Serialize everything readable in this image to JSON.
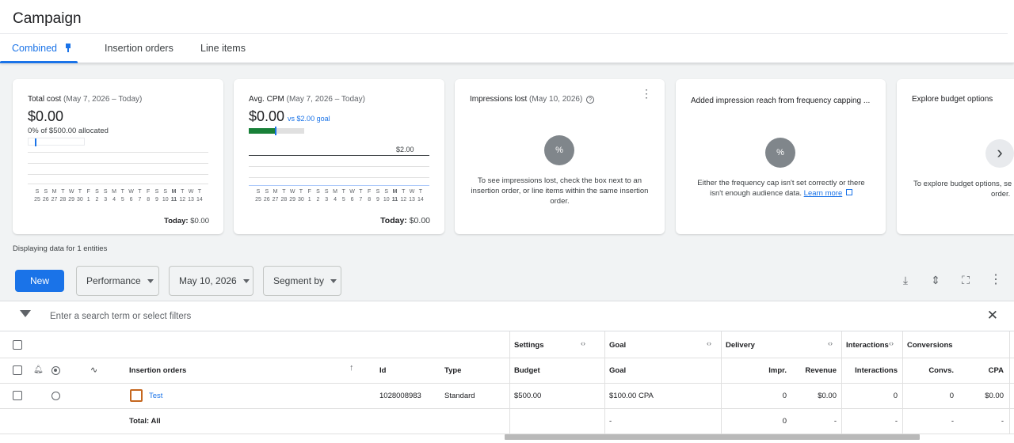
{
  "header": {
    "title": "Campaign",
    "tabs": [
      {
        "label": "Combined"
      },
      {
        "label": "Insertion orders"
      },
      {
        "label": "Line items"
      }
    ]
  },
  "cards": {
    "total_cost": {
      "title": "Total cost",
      "range": "(May 7, 2026 – Today)",
      "value": "$0.00",
      "note": "0% of $500.00 allocated",
      "today_label": "Today:",
      "today_value": "$0.00"
    },
    "avg_cpm": {
      "title": "Avg. CPM",
      "range": "(May 7, 2026 – Today)",
      "value": "$0.00",
      "goal": "vs $2.00 goal",
      "goal_line_label": "$2.00",
      "today_label": "Today:",
      "today_value": "$0.00"
    },
    "impressions_lost": {
      "title": "Impressions lost",
      "range": "(May 10, 2026)",
      "icon": "%",
      "message": "To see impressions lost, check the box next to an insertion order, or line items within the same insertion order."
    },
    "frequency": {
      "title": "Added impression reach from frequency capping ...",
      "icon": "%",
      "message": "Either the frequency cap isn't set correctly or there isn't enough audience data.",
      "link": "Learn more"
    },
    "budget": {
      "title": "Explore budget options",
      "message": "To explore budget options, se",
      "message2": "order."
    }
  },
  "chart_days": [
    "S",
    "S",
    "M",
    "T",
    "W",
    "T",
    "F",
    "S",
    "S",
    "M",
    "T",
    "W",
    "T",
    "F",
    "S",
    "S",
    "M",
    "T",
    "W",
    "T"
  ],
  "chart_dates": [
    "25",
    "26",
    "27",
    "28",
    "29",
    "30",
    "1",
    "2",
    "3",
    "4",
    "5",
    "6",
    "7",
    "8",
    "9",
    "10",
    "11",
    "12",
    "13",
    "14"
  ],
  "toolbar": {
    "displaying": "Displaying data for 1 entities",
    "new_label": "New",
    "performance_label": "Performance",
    "date_label": "May 10, 2026",
    "segment_label": "Segment by"
  },
  "filter": {
    "placeholder": "Enter a search term or select filters"
  },
  "table": {
    "groups": {
      "settings": "Settings",
      "goal": "Goal",
      "delivery": "Delivery",
      "interactions": "Interactions",
      "conversions": "Conversions"
    },
    "columns": {
      "name": "Insertion orders",
      "id": "Id",
      "type": "Type",
      "budget": "Budget",
      "goal": "Goal",
      "impr": "Impr.",
      "revenue": "Revenue",
      "interactions": "Interactions",
      "convs": "Convs.",
      "cpa": "CPA"
    },
    "row": {
      "name": "Test",
      "id": "1028008983",
      "type": "Standard",
      "budget": "$500.00",
      "goal": "$100.00 CPA",
      "impr": "0",
      "revenue": "$0.00",
      "interactions": "0",
      "convs": "0",
      "cpa": "$0.00"
    },
    "total": {
      "name": "Total: All",
      "goal": "-",
      "impr": "0",
      "revenue": "-",
      "interactions": "-",
      "convs": "-",
      "cpa": "-"
    }
  }
}
